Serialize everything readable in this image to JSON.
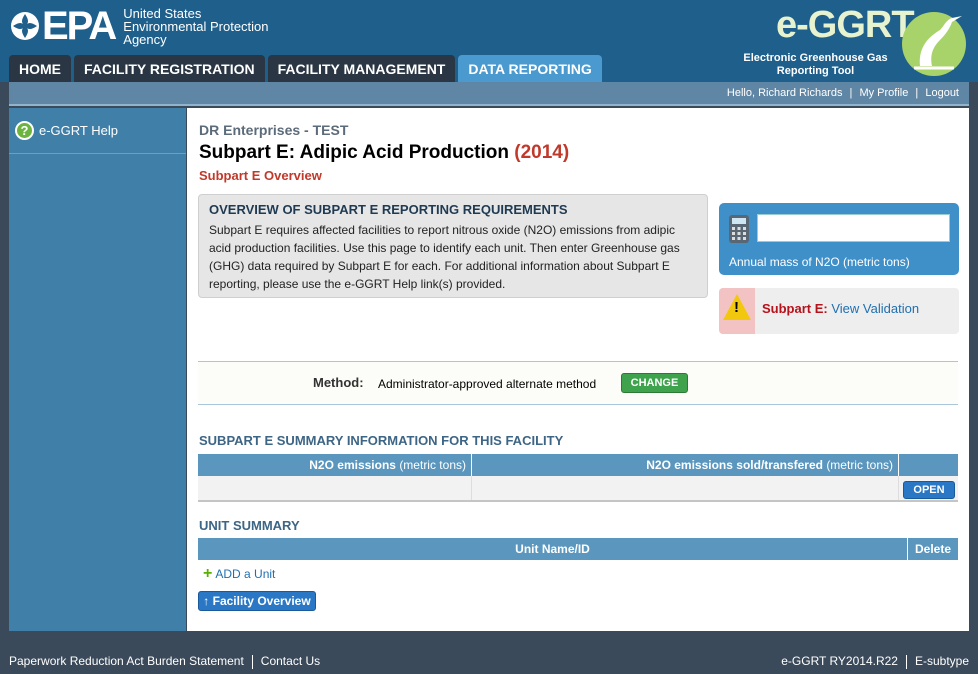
{
  "header": {
    "epa_mark": "EPA",
    "epa_name": [
      "United States",
      "Environmental Protection",
      "Agency"
    ],
    "nav": [
      "HOME",
      "FACILITY REGISTRATION",
      "FACILITY MANAGEMENT",
      "DATA REPORTING"
    ],
    "brand_title": "e-GGRT",
    "brand_sub": [
      "Electronic Greenhouse Gas",
      "Reporting Tool"
    ]
  },
  "userbar": {
    "greeting": "Hello, Richard Richards",
    "profile": "My Profile",
    "logout": "Logout",
    "sep": "|"
  },
  "sidebar": {
    "help_label": "e-GGRT Help",
    "help_glyph": "?"
  },
  "main": {
    "company": "DR Enterprises - TEST",
    "title": "Subpart E: Adipic Acid Production",
    "year": "(2014)",
    "subtitle": "Subpart E Overview",
    "overview_title": "OVERVIEW OF SUBPART E REPORTING REQUIREMENTS",
    "overview_text": "Subpart E requires affected facilities to report nitrous oxide (N2O) emissions from adipic acid production facilities. Use this page to identify each unit. Then enter Greenhouse gas (GHG) data required by Subpart E for each. For additional information about Subpart E reporting, please use the e-GGRT Help link(s) provided.",
    "n2o_label": "Annual mass of N2O (metric tons)",
    "n2o_value": "",
    "validation_label": "Subpart E:",
    "validation_link": "View Validation",
    "validation_mark": "!",
    "method_label": "Method:",
    "method_value": "Administrator-approved alternate method",
    "change_label": "CHANGE",
    "summary_title": "SUBPART E SUMMARY INFORMATION FOR THIS FACILITY",
    "summary_cols": [
      {
        "label": "N2O emissions",
        "unit": "(metric tons)"
      },
      {
        "label": "N2O emissions sold/transfered",
        "unit": "(metric tons)"
      }
    ],
    "open_label": "OPEN",
    "unit_title": "UNIT SUMMARY",
    "unit_cols": [
      "Unit Name/ID",
      "Delete"
    ],
    "add_unit": "ADD a Unit",
    "add_plus": "+",
    "facility_overview": "↑ Facility Overview"
  },
  "footer": {
    "left": "Paperwork Reduction Act Burden Statement",
    "contact": "Contact Us",
    "version": "e-GGRT RY2014.R22",
    "subtype": "E-subtype"
  },
  "colors": {
    "header_blue": "#1f5f8b",
    "active_tab": "#4a9ad0",
    "accent_red": "#c0392b",
    "change_green": "#3fa34d",
    "link_blue": "#1f6fb0"
  }
}
